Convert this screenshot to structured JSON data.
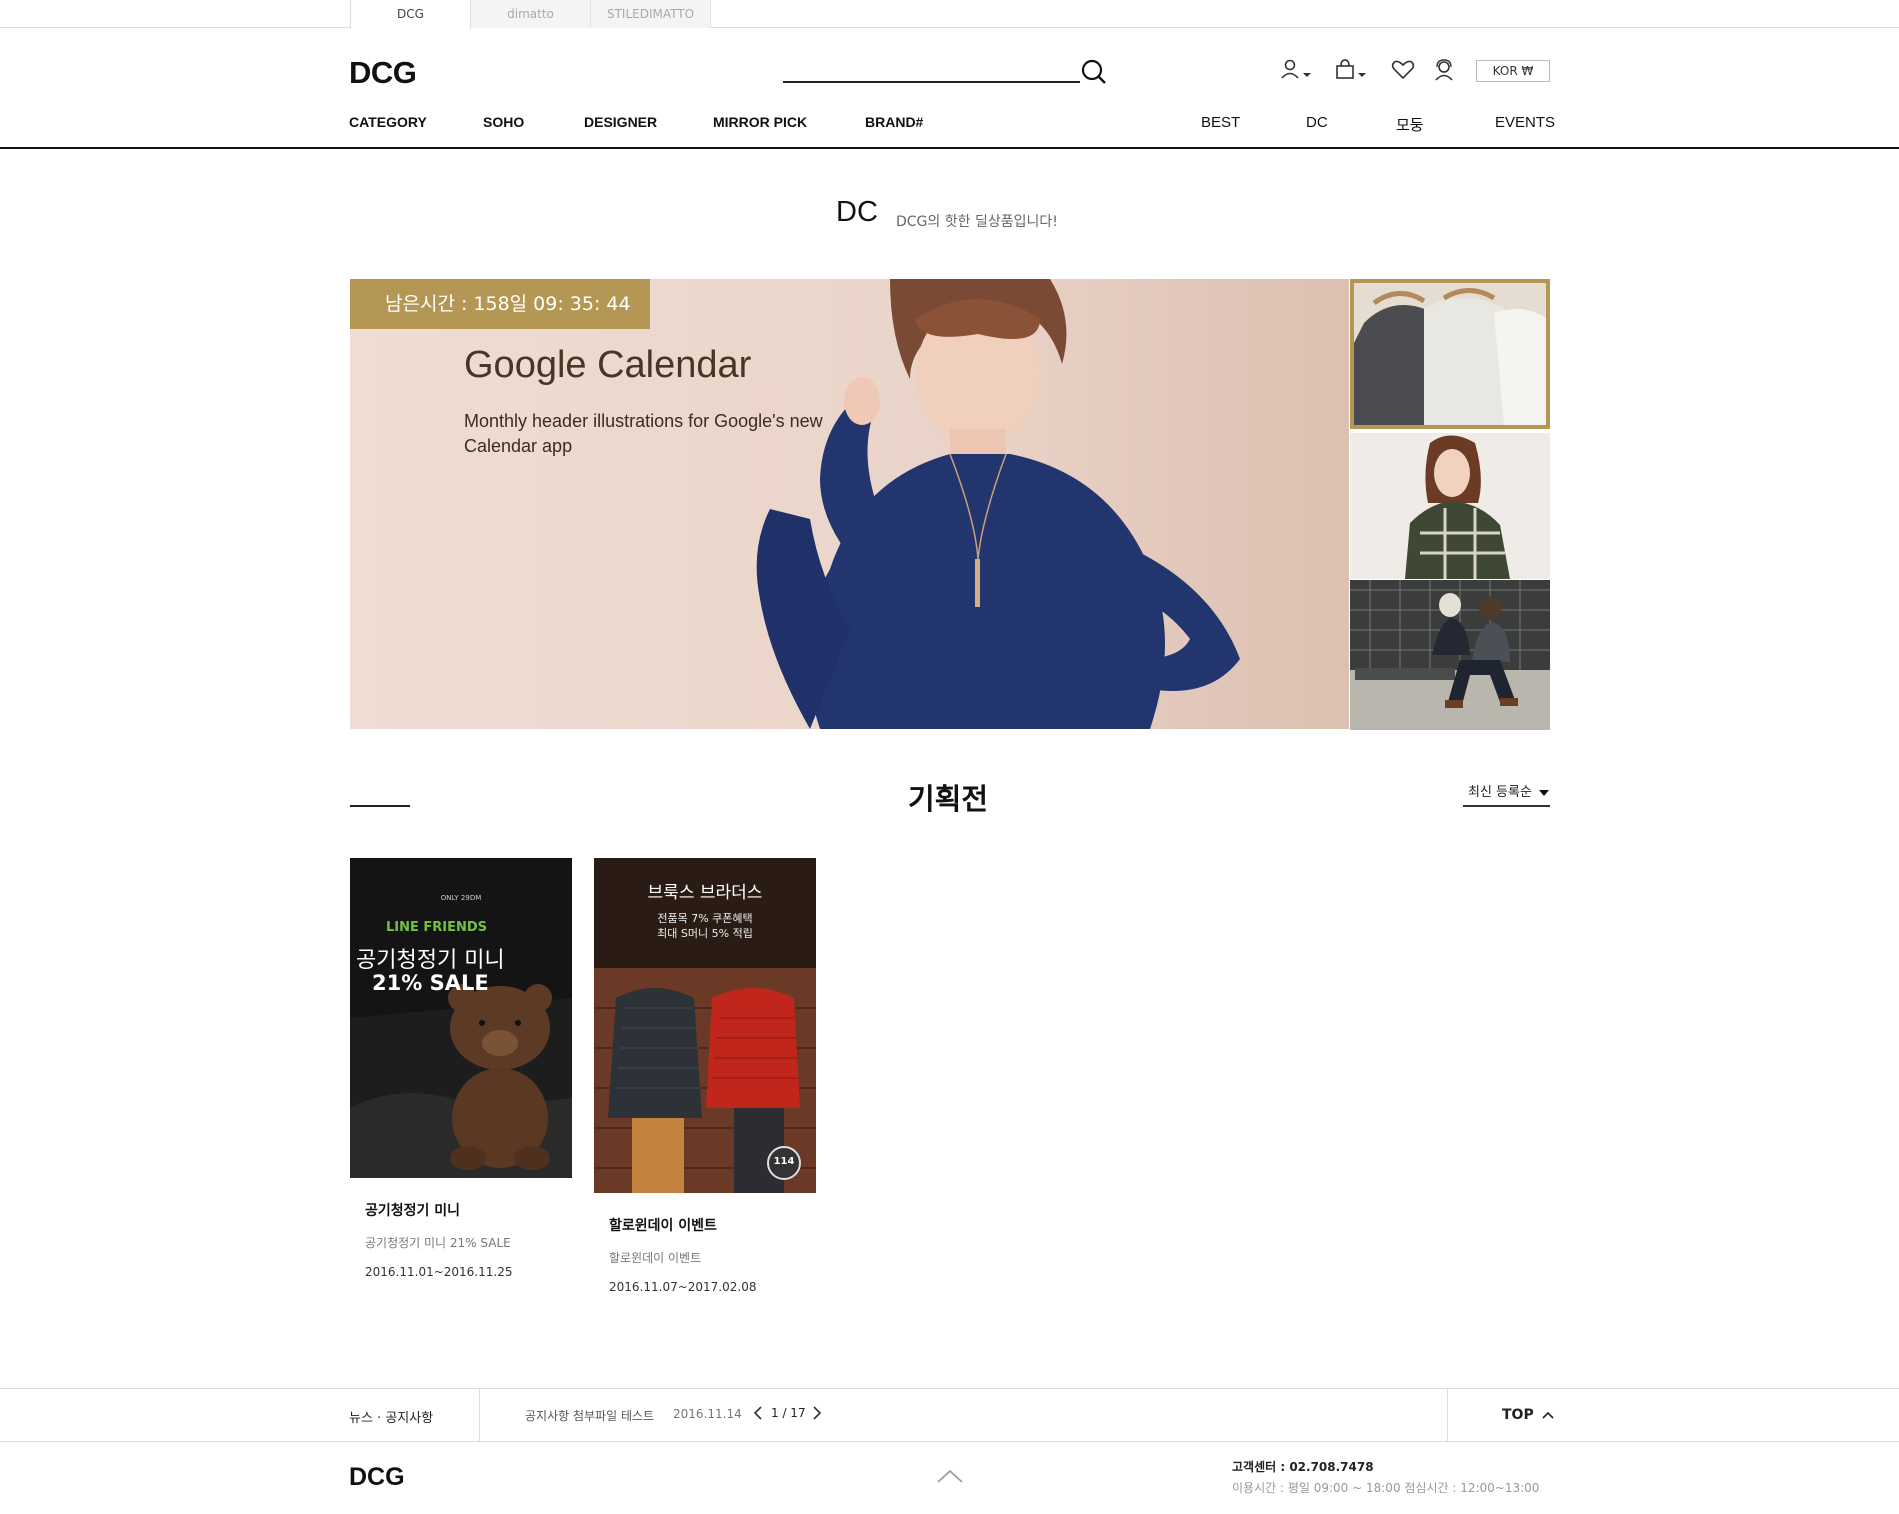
{
  "site_tabs": [
    "DCG",
    "dimatto",
    "STILEDIMATTO"
  ],
  "header": {
    "logo": "DCG",
    "search_placeholder": "",
    "icons": [
      "user-icon",
      "cart-icon",
      "heart-icon",
      "headset-icon"
    ],
    "lang_button": "KOR ₩"
  },
  "nav": {
    "left": [
      "CATEGORY",
      "SOHO",
      "DESIGNER",
      "MIRROR PICK",
      "BRAND#"
    ],
    "right": [
      "BEST",
      "DC",
      "모둥",
      "EVENTS"
    ]
  },
  "section": {
    "title": "DC",
    "subtitle": "DCG의 핫한 딜상품입니다!"
  },
  "hero": {
    "timer": "남은시간 : 158일 09: 35: 44",
    "title": "Google Calendar",
    "description": "Monthly header illustrations for Google's new Calendar app"
  },
  "exhibition": {
    "title": "기획전",
    "sort": "최신 등록순",
    "cards": [
      {
        "banner": {
          "top": "ONLY 29DM",
          "brand": "LINE FRIENDS",
          "headline": "공기청정기 미니",
          "sale": "21% SALE"
        },
        "name": "공기청정기 미니",
        "desc": "공기청정기 미니 21% SALE",
        "date": "2016.11.01~2016.11.25"
      },
      {
        "banner": {
          "top": "브룩스 브라더스",
          "line1": "전품목 7% 쿠폰혜택",
          "line2": "최대 S머니 5% 적립",
          "badge": "114"
        },
        "name": "할로윈데이 이벤트",
        "desc": "할로윈데이 이벤트",
        "date": "2016.11.07~2017.02.08"
      }
    ]
  },
  "news": {
    "label": "뉴스 · 공지사항",
    "title": "공지사항 첨부파일 테스트",
    "date": "2016.11.14",
    "page": "1 / 17",
    "top": "TOP"
  },
  "footer": {
    "logo": "DCG",
    "cs_label": "고객센터 : 02.708.7478",
    "hours": "이용시간 : 평일 09:00 ~ 18:00 점심시간 : 12:00~13:00"
  },
  "colors": {
    "accent_gold": "#b49755",
    "text": "#222222",
    "hero_bg": "#ead4c9"
  }
}
